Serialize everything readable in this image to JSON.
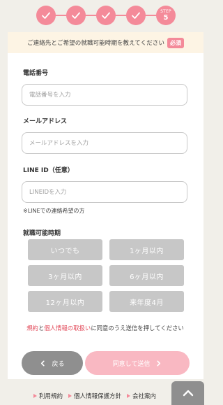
{
  "steps": {
    "completed_count": 4,
    "current_label": "STEP",
    "current_number": "5"
  },
  "notice": {
    "text": "ご連絡先とご希望の就職可能時期を教えてください",
    "required_badge": "必須"
  },
  "phone": {
    "label": "電話番号",
    "placeholder": "電話番号を入力",
    "value": ""
  },
  "email": {
    "label": "メールアドレス",
    "placeholder": "メールアドレスを入力",
    "value": ""
  },
  "line": {
    "label": "LINE ID（任意）",
    "placeholder": "LINEIDを入力",
    "value": "",
    "note": "※LINEでの連絡希望の方"
  },
  "availability": {
    "label": "就職可能時期",
    "options": [
      "いつでも",
      "1ヶ月以内",
      "3ヶ月以内",
      "6ヶ月以内",
      "12ヶ月以内",
      "来年度4月"
    ]
  },
  "consent": {
    "terms_link": "規約",
    "connector": "と",
    "privacy_link": "個人情報の取扱い",
    "rest": "に同意のうえ送信を押してください"
  },
  "buttons": {
    "back": "戻る",
    "submit": "同意して送信"
  },
  "footer": {
    "links": [
      "利用規約",
      "個人情報保護方針",
      "会社案内"
    ]
  },
  "colors": {
    "accent": "#f48a99",
    "choice_bg": "#c7c7c7",
    "submit_bg": "#f9b8c2",
    "back_bg": "#8f8f8f",
    "link": "#e24a5a"
  }
}
